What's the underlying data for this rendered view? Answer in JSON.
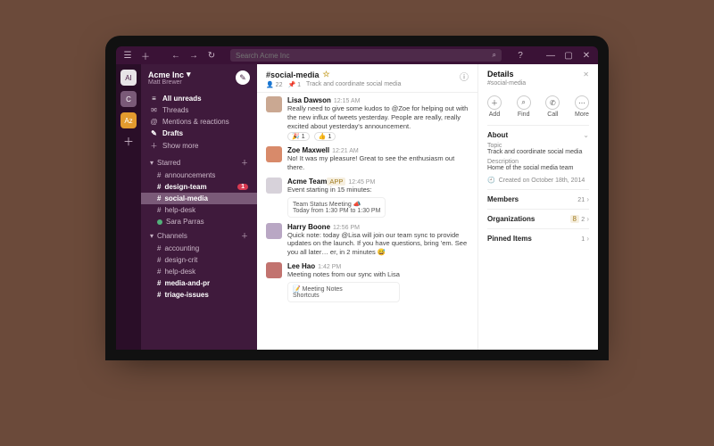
{
  "workspace": {
    "name": "Acme Inc",
    "user": "Matt Brewer",
    "search_placeholder": "Search Acme Inc"
  },
  "nav": {
    "unreads": "All unreads",
    "threads": "Threads",
    "mentions": "Mentions & reactions",
    "drafts": "Drafts",
    "show_more": "Show more"
  },
  "sections": {
    "starred": {
      "label": "Starred",
      "items": [
        {
          "type": "channel",
          "name": "announcements",
          "bold": false
        },
        {
          "type": "channel",
          "name": "design-team",
          "bold": true,
          "badge": "1"
        },
        {
          "type": "channel",
          "name": "social-media",
          "bold": true,
          "selected": true
        },
        {
          "type": "channel",
          "name": "help-desk",
          "bold": false
        },
        {
          "type": "dm",
          "name": "Sara Parras",
          "bold": false
        }
      ]
    },
    "channels": {
      "label": "Channels",
      "items": [
        {
          "name": "accounting"
        },
        {
          "name": "design-crit"
        },
        {
          "name": "help-desk"
        },
        {
          "name": "media-and-pr",
          "bold": true
        },
        {
          "name": "triage-issues",
          "bold": true
        }
      ]
    }
  },
  "channel_header": {
    "name": "#social-media",
    "star": "☆",
    "members": "22",
    "pins": "1",
    "topic": "Track and coordinate social media"
  },
  "messages": [
    {
      "author": "Lisa Dawson",
      "time": "12:15 AM",
      "avatar": "#caa892",
      "text": "Really need to give some kudos to @Zoe for helping out with the new influx of tweets yesterday. People are really, really excited about yesterday's announcement.",
      "reactions": [
        {
          "emoji": "🎉",
          "count": "1"
        },
        {
          "emoji": "👍",
          "count": "1"
        }
      ]
    },
    {
      "author": "Zoe Maxwell",
      "time": "12:21 AM",
      "avatar": "#d88a6a",
      "text": "No! It was my pleasure! Great to see the enthusiasm out there."
    },
    {
      "author": "Acme Team",
      "time": "12:45 PM",
      "avatar": "#d7d2da",
      "app": true,
      "text": "Event starting in 15 minutes:",
      "attachment": {
        "title": "Team Status Meeting 📣",
        "line": "Today from 1:30 PM to 1:30 PM"
      }
    },
    {
      "author": "Harry Boone",
      "time": "12:56 PM",
      "avatar": "#b9a7c4",
      "text": "Quick note: today @Lisa will join our team sync to provide updates on the launch. If you have questions, bring 'em. See you all later… er, in 2 minutes 😅"
    },
    {
      "author": "Lee Hao",
      "time": "1:42 PM",
      "avatar": "#c2736f",
      "text": "Meeting notes from our sync with Lisa",
      "attachment": {
        "title": "📝 Meeting Notes",
        "line": "Shortcuts"
      }
    }
  ],
  "details": {
    "title": "Details",
    "subtitle": "#social-media",
    "actions": {
      "add": "Add",
      "find": "Find",
      "call": "Call",
      "more": "More"
    },
    "about": {
      "label": "About",
      "topic_label": "Topic",
      "topic": "Track and coordinate social media",
      "desc_label": "Description",
      "desc": "Home of the social media team",
      "created": "Created on October 18th, 2014"
    },
    "members": {
      "label": "Members",
      "count": "21"
    },
    "orgs": {
      "label": "Organizations",
      "count": "2",
      "badge": "8"
    },
    "pinned": {
      "label": "Pinned Items",
      "count": "1"
    }
  }
}
